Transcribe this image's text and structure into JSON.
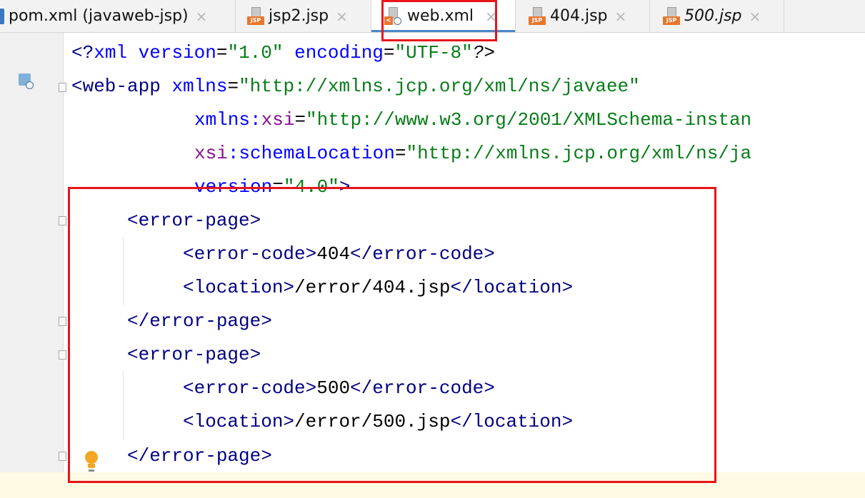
{
  "tabs": [
    {
      "name": "pom.xml (javaweb-jsp)",
      "icon": "maven-icon",
      "close": "×",
      "active": false,
      "italic": false
    },
    {
      "name": "jsp2.jsp",
      "icon": "jsp-file-icon",
      "icon_label": "JSP",
      "close": "×",
      "active": false,
      "italic": false
    },
    {
      "name": "web.xml",
      "icon": "xml-web-file-icon",
      "icon_label": "<",
      "close": "×",
      "active": true,
      "italic": false
    },
    {
      "name": "404.jsp",
      "icon": "jsp-file-icon",
      "icon_label": "JSP",
      "close": "×",
      "active": false,
      "italic": false
    },
    {
      "name": "500.jsp",
      "icon": "jsp-file-icon",
      "icon_label": "JSP",
      "close": "×",
      "active": false,
      "italic": true
    }
  ],
  "code": {
    "decl_open": "<?",
    "decl_name": "xml",
    "version_attr": "version",
    "version_val": "\"1.0\"",
    "encoding_attr": "encoding",
    "encoding_val": "\"UTF-8\"",
    "decl_close": "?>",
    "webapp_open": "<web-app",
    "xmlns_attr": "xmlns",
    "xmlns_val": "\"http://xmlns.jcp.org/xml/ns/javaee\"",
    "xsi_prefix": "xmlns:",
    "xsi_name": "xsi",
    "xsi_val": "\"http://www.w3.org/2001/XMLSchema-instan",
    "schema_prefix": "xsi",
    "schema_attr": ":schemaLocation",
    "schema_val": "\"http://xmlns.jcp.org/xml/ns/ja",
    "webapp_version_attr": "version",
    "webapp_version_val": "\"4.0\"",
    "tag_end": ">",
    "error_page_open": "<error-page>",
    "error_page_close": "</error-page>",
    "error_code_open": "<error-code>",
    "error_code_close": "</error-code>",
    "location_open": "<location>",
    "location_close": "</location>",
    "eq": "=",
    "code_404": "404",
    "location_404": "/error/404.jsp",
    "code_500": "500",
    "location_500": "/error/500.jsp"
  },
  "colors": {
    "tag": "#000080",
    "attribute": "#0000ff",
    "value": "#067d17",
    "namespace": "#871094",
    "highlight_box": "#e8141b",
    "active_tab_underline": "#4a88c7"
  }
}
